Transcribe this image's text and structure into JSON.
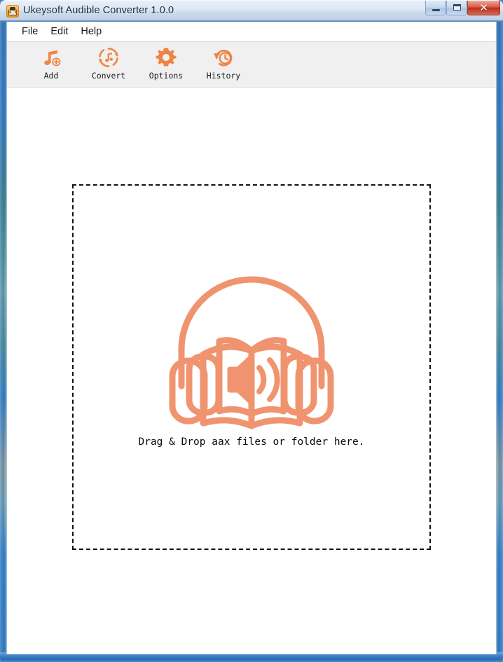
{
  "window": {
    "title": "Ukeysoft Audible Converter 1.0.0",
    "app_icon": "audiobook-app-icon",
    "controls": {
      "minimize_label": "–",
      "maximize_label": "□",
      "close_label": "✕",
      "minimize_name": "minimize-button",
      "maximize_name": "maximize-button",
      "close_name": "close-button"
    }
  },
  "menubar": {
    "items": [
      {
        "label": "File"
      },
      {
        "label": "Edit"
      },
      {
        "label": "Help"
      }
    ]
  },
  "toolbar": {
    "buttons": [
      {
        "label": "Add",
        "icon": "music-note-plus-icon"
      },
      {
        "label": "Convert",
        "icon": "refresh-music-note-icon"
      },
      {
        "label": "Options",
        "icon": "gear-icon"
      },
      {
        "label": "History",
        "icon": "clock-rewind-icon"
      }
    ]
  },
  "dropzone": {
    "illustration": "audiobook-headphones-book-speaker-icon",
    "message": "Drag & Drop aax files or folder here."
  },
  "colors": {
    "accent_orange": "#F08444",
    "illustration_salmon": "#F09470",
    "toolbar_bg": "#F0F0F0",
    "client_bg": "#FFFFFF",
    "titlebar_top": "#E8EFF8",
    "titlebar_bottom": "#B7CAE4",
    "close_button_red": "#B8301C",
    "dropzone_border": "#111111"
  }
}
